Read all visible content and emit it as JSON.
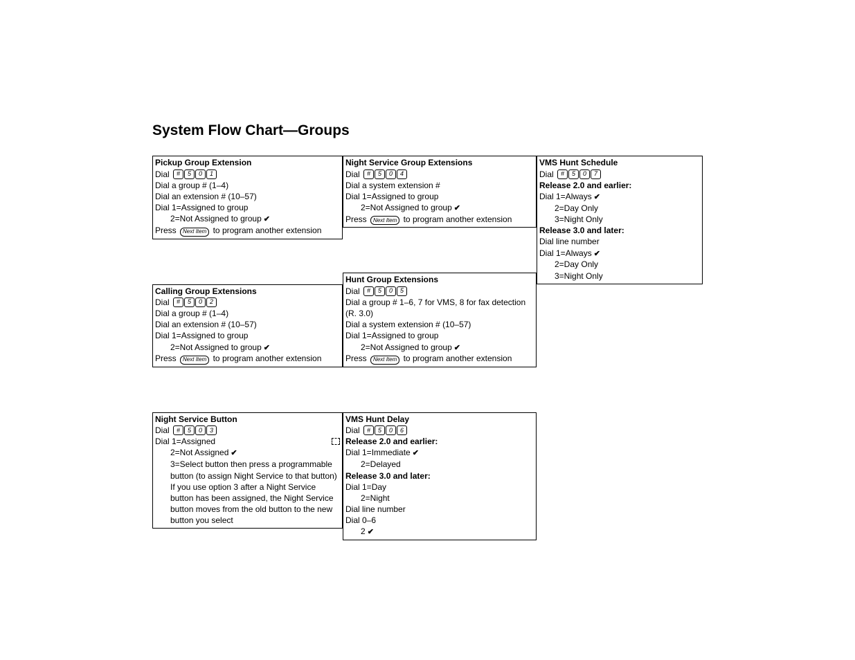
{
  "title": "System Flow Chart—Groups",
  "labels": {
    "dial": "Dial",
    "press": "Press",
    "nextItem": "Next Item",
    "pressSuffix": " to program another extension"
  },
  "col1": {
    "pickup": {
      "title": "Pickup Group Extension",
      "code": [
        "#",
        "5",
        "0",
        "1"
      ],
      "l1": "Dial a group # (1–4)",
      "l2": "Dial an extension # (10–57)",
      "l3": "Dial 1=Assigned to group",
      "l4": "2=Not Assigned to group"
    },
    "calling": {
      "title": "Calling Group Extensions",
      "code": [
        "#",
        "5",
        "0",
        "2"
      ],
      "l1": "Dial a group # (1–4)",
      "l2": "Dial an extension # (10–57)",
      "l3": "Dial 1=Assigned to group",
      "l4": "2=Not Assigned to group"
    },
    "nsButton": {
      "title": "Night Service Button",
      "code": [
        "#",
        "5",
        "0",
        "3"
      ],
      "l1": "Dial 1=Assigned",
      "l2": "2=Not Assigned",
      "l3": "3=Select button then press a programmable button (to assign Night Service to that button)",
      "l4": "If you use option 3 after a Night Service button has been assigned, the Night Service button moves from the old button to the new button you select"
    }
  },
  "col2": {
    "nsGroup": {
      "title": "Night Service Group Extensions",
      "code": [
        "#",
        "5",
        "0",
        "4"
      ],
      "l1": "Dial a system extension #",
      "l2": "Dial 1=Assigned to group",
      "l3": "2=Not Assigned to group"
    },
    "hunt": {
      "title": "Hunt Group Extensions",
      "code": [
        "#",
        "5",
        "0",
        "5"
      ],
      "l1": "Dial a group # 1–6, 7 for VMS, 8 for fax detection (R. 3.0)",
      "l2": "Dial a system extension # (10–57)",
      "l3": "Dial 1=Assigned to group",
      "l4": "2=Not Assigned to group"
    },
    "vmsDelay": {
      "title": "VMS Hunt Delay",
      "code": [
        "#",
        "5",
        "0",
        "6"
      ],
      "r2": "Release 2.0 and earlier:",
      "r2a": "Dial 1=Immediate",
      "r2b": "2=Delayed",
      "r3": "Release 3.0 and later:",
      "r3a": "Dial 1=Day",
      "r3b": "2=Night",
      "r3c": "Dial line number",
      "r3d": "Dial 0–6",
      "r3e": "2"
    }
  },
  "col3": {
    "vmsSched": {
      "title": "VMS Hunt Schedule",
      "code": [
        "#",
        "5",
        "0",
        "7"
      ],
      "r2": "Release 2.0 and earlier:",
      "r2a": "Dial 1=Always",
      "r2b": "2=Day Only",
      "r2c": "3=Night Only",
      "r3": "Release 3.0 and later:",
      "r3a": "Dial line number",
      "r3b": "Dial 1=Always",
      "r3c": "2=Day Only",
      "r3d": "3=Night Only"
    }
  }
}
